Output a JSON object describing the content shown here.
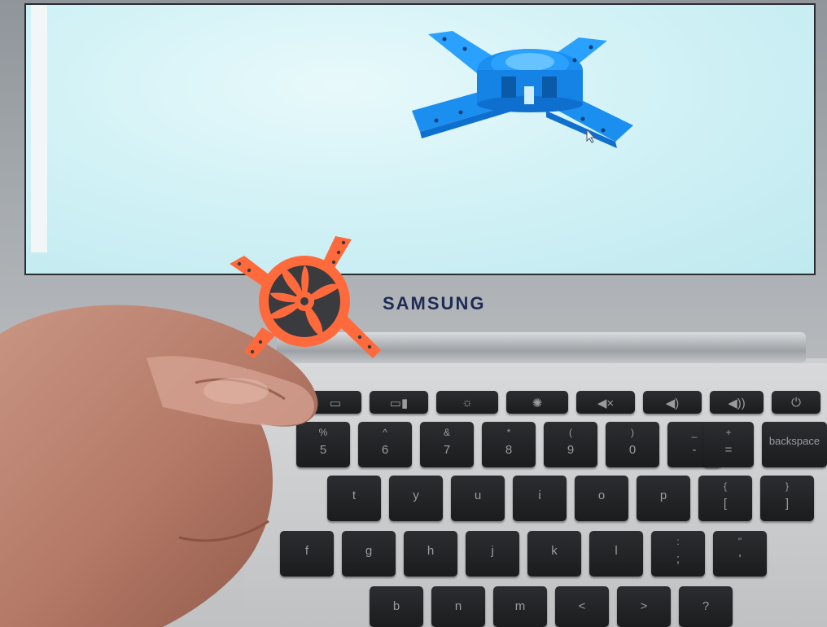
{
  "scene": {
    "description_icons": [
      "laptop-icon"
    ],
    "brand_logo_text": "SAMSUNG"
  },
  "keyboard": {
    "function_row": [
      "",
      "",
      "",
      "",
      "",
      "",
      "",
      "⏻"
    ],
    "number_row": [
      {
        "top": "%",
        "bottom": "5"
      },
      {
        "top": "^",
        "bottom": "6"
      },
      {
        "top": "&",
        "bottom": "7"
      },
      {
        "top": "*",
        "bottom": "8"
      },
      {
        "top": "(",
        "bottom": "9"
      },
      {
        "top": ")",
        "bottom": "0"
      },
      {
        "top": "_",
        "bottom": "-"
      },
      {
        "top": "+",
        "bottom": "="
      }
    ],
    "backspace_label": "backspace",
    "top_row": [
      "t",
      "y",
      "u",
      "i",
      "o",
      "p"
    ],
    "bracket_keys": [
      {
        "top": "{",
        "bottom": "["
      },
      {
        "top": "}",
        "bottom": "]"
      }
    ],
    "home_row": [
      "f",
      "g",
      "h",
      "j",
      "k",
      "l"
    ],
    "semicolon_key": {
      "top": ":",
      "bottom": ";"
    },
    "quote_key": {
      "top": "\"",
      "bottom": "'"
    },
    "bottom_row": [
      "b",
      "n",
      "m",
      "<",
      ">",
      "?"
    ]
  },
  "colors": {
    "model_blue": "#1e9cff",
    "part_orange": "#ff6a3d",
    "screen_bg": "#cdeff4"
  }
}
